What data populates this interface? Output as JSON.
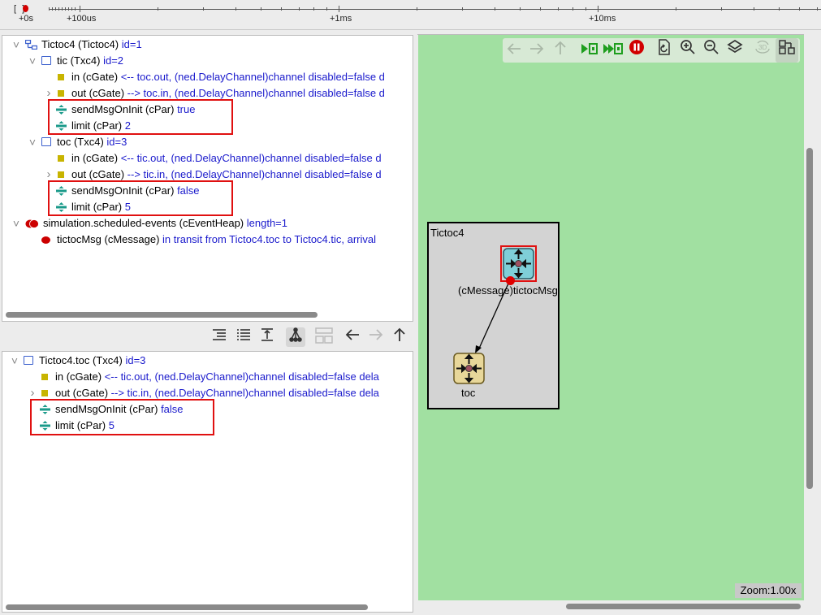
{
  "timeline": {
    "bracket": "[       ]",
    "labels": [
      "+0s",
      "+100us",
      "+1ms",
      "+10ms"
    ]
  },
  "object_tree": {
    "rows": [
      {
        "name": "Tictoc4 (Tictoc4)",
        "info": "id=1"
      },
      {
        "name": "tic (Txc4)",
        "info": "id=2"
      },
      {
        "name": "in (cGate)",
        "info": "<-- toc.out, (ned.DelayChannel)channel disabled=false d"
      },
      {
        "name": "out (cGate)",
        "info": "--> toc.in, (ned.DelayChannel)channel disabled=false d"
      },
      {
        "name": "sendMsgOnInit (cPar)",
        "info": "true"
      },
      {
        "name": "limit (cPar)",
        "info": "2"
      },
      {
        "name": "toc (Txc4)",
        "info": "id=3"
      },
      {
        "name": "in (cGate)",
        "info": "<-- tic.out, (ned.DelayChannel)channel disabled=false d"
      },
      {
        "name": "out (cGate)",
        "info": "--> tic.in, (ned.DelayChannel)channel disabled=false d"
      },
      {
        "name": "sendMsgOnInit (cPar)",
        "info": "false"
      },
      {
        "name": "limit (cPar)",
        "info": "5"
      },
      {
        "name": "simulation.scheduled-events (cEventHeap)",
        "info": "length=1"
      },
      {
        "name": "tictocMsg (cMessage)",
        "info": "in transit from Tictoc4.toc to Tictoc4.tic, arrival"
      }
    ]
  },
  "inspector": {
    "rows": [
      {
        "name": "Tictoc4.toc (Txc4)",
        "info": "id=3"
      },
      {
        "name": "in (cGate)",
        "info": "<-- tic.out, (ned.DelayChannel)channel disabled=false dela"
      },
      {
        "name": "out (cGate)",
        "info": "--> tic.in, (ned.DelayChannel)channel disabled=false dela"
      },
      {
        "name": "sendMsgOnInit (cPar)",
        "info": "false"
      },
      {
        "name": "limit (cPar)",
        "info": "5"
      }
    ]
  },
  "network": {
    "title": "Tictoc4",
    "message_label": "(cMessage)tictocMsg",
    "toc_label": "toc",
    "zoom": "Zoom:1.00x"
  },
  "colors": {
    "canvas": "#a1e0a1",
    "highlight": "#e01010",
    "info_text": "#1a1acc"
  }
}
